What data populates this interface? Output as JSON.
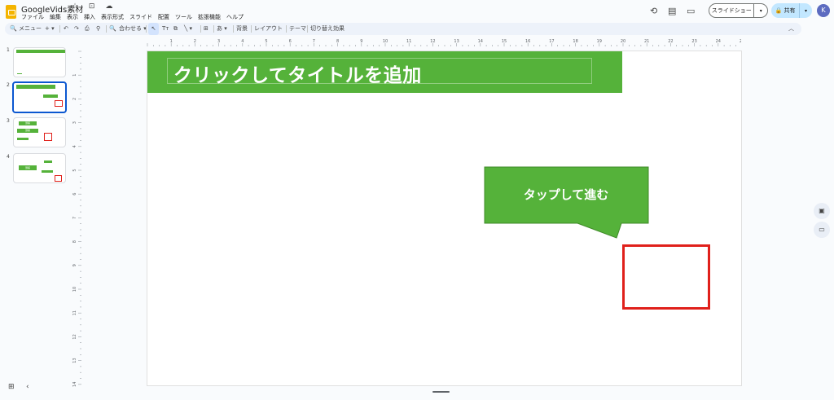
{
  "header": {
    "doc_title": "GoogleVids素材",
    "title_icons": "☆ ⊡ ☁",
    "menu": [
      "ファイル",
      "編集",
      "表示",
      "挿入",
      "表示形式",
      "スライド",
      "配置",
      "ツール",
      "拡張機能",
      "ヘルプ"
    ],
    "history_icon": "⟲",
    "comment_icon": "▤",
    "meet_icon": "▭",
    "present_label": "スライドショー",
    "present_arrow": "▾",
    "share_label": "🔒 共有",
    "share_arrow": "▾",
    "avatar": "K"
  },
  "toolbar": {
    "menu_search": "🔍 メニュー",
    "add": "+ ▾",
    "undo": "↶",
    "redo": "↷",
    "print": "⎙",
    "paint": "⚲",
    "zoom_icon": "🔍",
    "zoom": "合わせる ▾",
    "select": "↖",
    "text": "Tт",
    "image": "⧉",
    "line": "╲ ▾",
    "comment": "⊞",
    "input": "あ ▾",
    "background": "背景",
    "layout": "レイアウト",
    "theme": "テーマ",
    "transition": "切り替え効果",
    "collapse": "︿"
  },
  "filmstrip": {
    "numbers": [
      "1",
      "2",
      "3",
      "4"
    ],
    "thumb3_labels": [
      "頭痛",
      "頭痛"
    ],
    "thumb4_labels": [
      "頭痛"
    ]
  },
  "ruler": {
    "top_labels": [
      "1",
      "2",
      "3",
      "4",
      "5",
      "6",
      "7",
      "8",
      "9",
      "10",
      "11",
      "12",
      "13",
      "14",
      "15",
      "16",
      "17",
      "18",
      "19",
      "20",
      "21",
      "22",
      "23",
      "24",
      "25"
    ],
    "left_labels": [
      "1",
      "2",
      "3",
      "4",
      "5",
      "6",
      "7",
      "8",
      "9",
      "10",
      "11",
      "12",
      "13",
      "14"
    ]
  },
  "slide": {
    "title": "クリックしてタイトルを追加",
    "callout": "タップして進む",
    "accent": "#55b23a",
    "red": "#e0201b"
  },
  "right_panel": [
    "▣",
    "▭"
  ],
  "bottom": {
    "grid_icon": "⊞",
    "collapse_icon": "‹"
  }
}
